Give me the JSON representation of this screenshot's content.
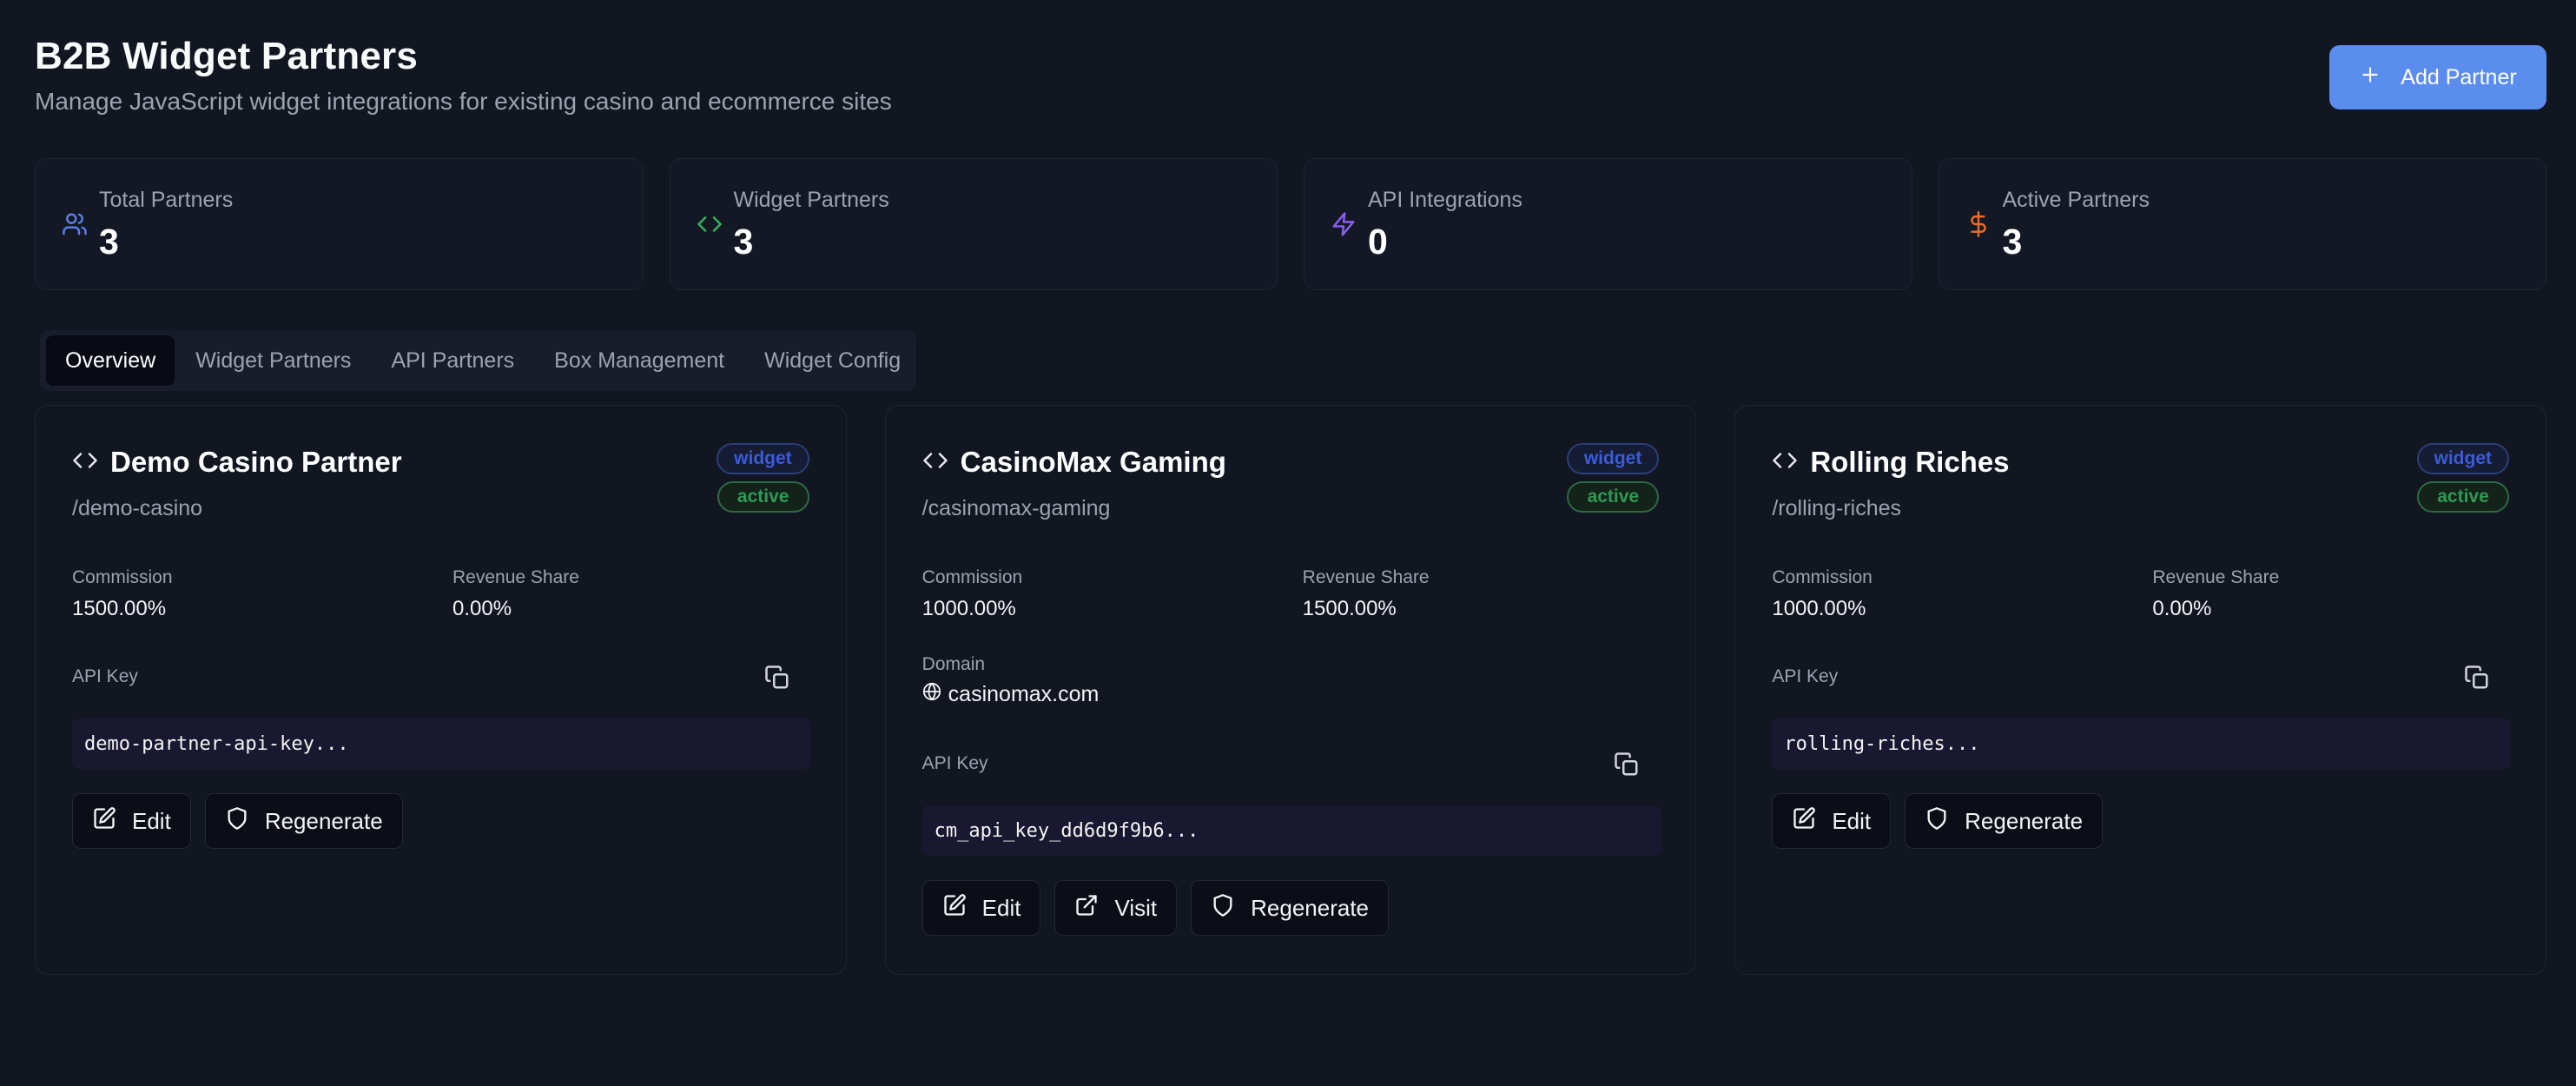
{
  "header": {
    "title": "B2B Widget Partners",
    "subtitle": "Manage JavaScript widget integrations for existing casino and ecommerce sites",
    "add_button_label": "Add Partner"
  },
  "stats": [
    {
      "label": "Total Partners",
      "value": "3",
      "icon": "users-icon",
      "color": "#5b7fe6"
    },
    {
      "label": "Widget Partners",
      "value": "3",
      "icon": "code-icon",
      "color": "#34b35a"
    },
    {
      "label": "API Integrations",
      "value": "0",
      "icon": "zap-icon",
      "color": "#8b5cf6"
    },
    {
      "label": "Active Partners",
      "value": "3",
      "icon": "dollar-icon",
      "color": "#ea6a2a"
    }
  ],
  "tabs": [
    {
      "label": "Overview",
      "active": true
    },
    {
      "label": "Widget Partners",
      "active": false
    },
    {
      "label": "API Partners",
      "active": false
    },
    {
      "label": "Box Management",
      "active": false
    },
    {
      "label": "Widget Config",
      "active": false
    }
  ],
  "labels": {
    "commission": "Commission",
    "revenue_share": "Revenue Share",
    "domain": "Domain",
    "api_key": "API Key",
    "edit": "Edit",
    "visit": "Visit",
    "regenerate": "Regenerate"
  },
  "partners": [
    {
      "name": "Demo Casino Partner",
      "slug": "/demo-casino",
      "type_badge": "widget",
      "status_badge": "active",
      "commission": "1500.00%",
      "revenue_share": "0.00%",
      "api_key": "demo-partner-api-key..."
    },
    {
      "name": "CasinoMax Gaming",
      "slug": "/casinomax-gaming",
      "type_badge": "widget",
      "status_badge": "active",
      "commission": "1000.00%",
      "revenue_share": "1500.00%",
      "domain": "casinomax.com",
      "api_key": "cm_api_key_dd6d9f9b6..."
    },
    {
      "name": "Rolling Riches",
      "slug": "/rolling-riches",
      "type_badge": "widget",
      "status_badge": "active",
      "commission": "1000.00%",
      "revenue_share": "0.00%",
      "api_key": "rolling-riches..."
    }
  ],
  "colors": {
    "background": "#121621",
    "accent": "#5b8def",
    "badge_widget": "#3b5bdb",
    "badge_active": "#2f9a55"
  }
}
